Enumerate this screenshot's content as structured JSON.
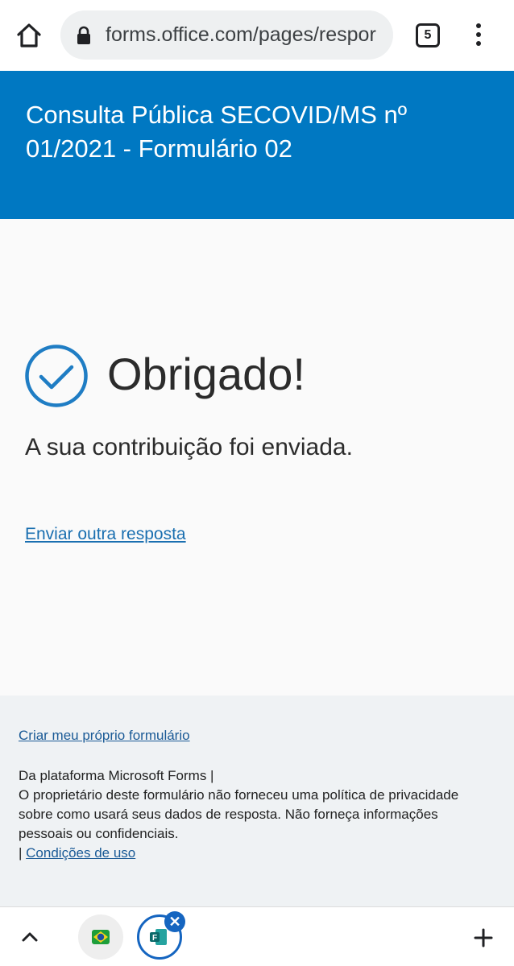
{
  "browser": {
    "url": "forms.office.com/pages/respor",
    "tab_count": "5"
  },
  "form": {
    "title": "Consulta Pública SECOVID/MS nº 01/2021 - Formulário 02"
  },
  "confirmation": {
    "title": "Obrigado!",
    "message": "A sua contribuição foi enviada.",
    "another_link": "Enviar outra resposta"
  },
  "footer": {
    "create_link": "Criar meu próprio formulário",
    "platform_text": "Da plataforma Microsoft Forms |",
    "privacy_text": "O proprietário deste formulário não forneceu uma política de privacidade sobre como usará seus dados de resposta. Não forneça informações pessoais ou confidenciais.",
    "separator": "|",
    "terms_link": "Condições de uso"
  },
  "bottom_bar": {
    "close_label": "✕",
    "icons": [
      "chevron-up-icon",
      "brazil-flag-icon",
      "forms-icon",
      "close-icon",
      "plus-icon"
    ]
  },
  "colors": {
    "header_blue": "#0078c2",
    "check_blue": "#1f7dc4",
    "link_blue": "#1a6fb0"
  }
}
